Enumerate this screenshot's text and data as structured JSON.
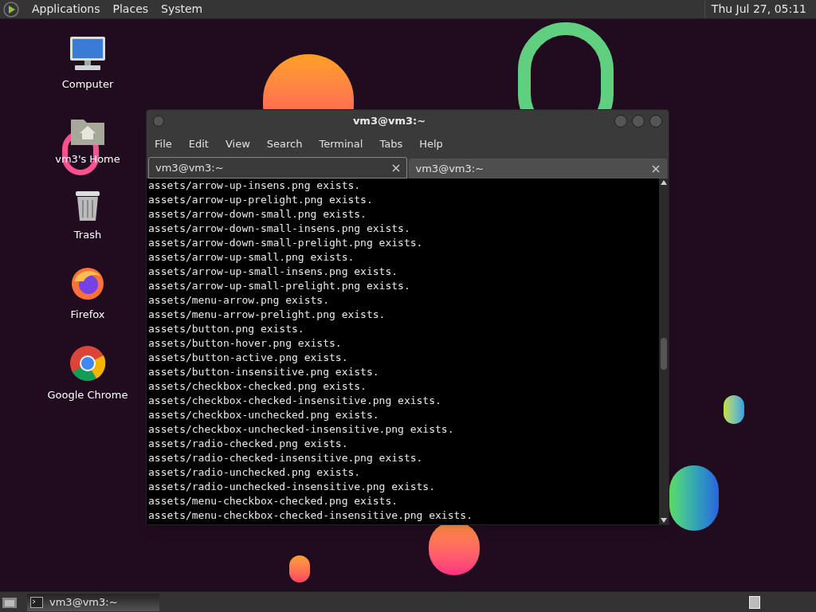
{
  "top_panel": {
    "menus": [
      "Applications",
      "Places",
      "System"
    ],
    "clock": "Thu Jul 27, 05:11"
  },
  "desktop_icons": [
    {
      "kind": "computer",
      "label": "Computer"
    },
    {
      "kind": "home",
      "label": "vm3's Home"
    },
    {
      "kind": "trash",
      "label": "Trash"
    },
    {
      "kind": "firefox",
      "label": "Firefox"
    },
    {
      "kind": "chrome",
      "label": "Google Chrome"
    }
  ],
  "window": {
    "title": "vm3@vm3:~",
    "menu": [
      "File",
      "Edit",
      "View",
      "Search",
      "Terminal",
      "Tabs",
      "Help"
    ],
    "tabs": [
      {
        "label": "vm3@vm3:~",
        "selected": true
      },
      {
        "label": "vm3@vm3:~",
        "selected": false
      }
    ],
    "lines": [
      "assets/arrow-up-insens.png exists.",
      "assets/arrow-up-prelight.png exists.",
      "assets/arrow-down-small.png exists.",
      "assets/arrow-down-small-insens.png exists.",
      "assets/arrow-down-small-prelight.png exists.",
      "assets/arrow-up-small.png exists.",
      "assets/arrow-up-small-insens.png exists.",
      "assets/arrow-up-small-prelight.png exists.",
      "assets/menu-arrow.png exists.",
      "assets/menu-arrow-prelight.png exists.",
      "assets/button.png exists.",
      "assets/button-hover.png exists.",
      "assets/button-active.png exists.",
      "assets/button-insensitive.png exists.",
      "assets/checkbox-checked.png exists.",
      "assets/checkbox-checked-insensitive.png exists.",
      "assets/checkbox-unchecked.png exists.",
      "assets/checkbox-unchecked-insensitive.png exists.",
      "assets/radio-checked.png exists.",
      "assets/radio-checked-insensitive.png exists.",
      "assets/radio-unchecked.png exists.",
      "assets/radio-unchecked-insensitive.png exists.",
      "assets/menu-checkbox-checked.png exists.",
      "assets/menu-checkbox-checked-insensitive.png exists."
    ]
  },
  "taskbar": {
    "tasks": [
      {
        "label": "vm3@vm3:~",
        "selected": true
      }
    ]
  }
}
